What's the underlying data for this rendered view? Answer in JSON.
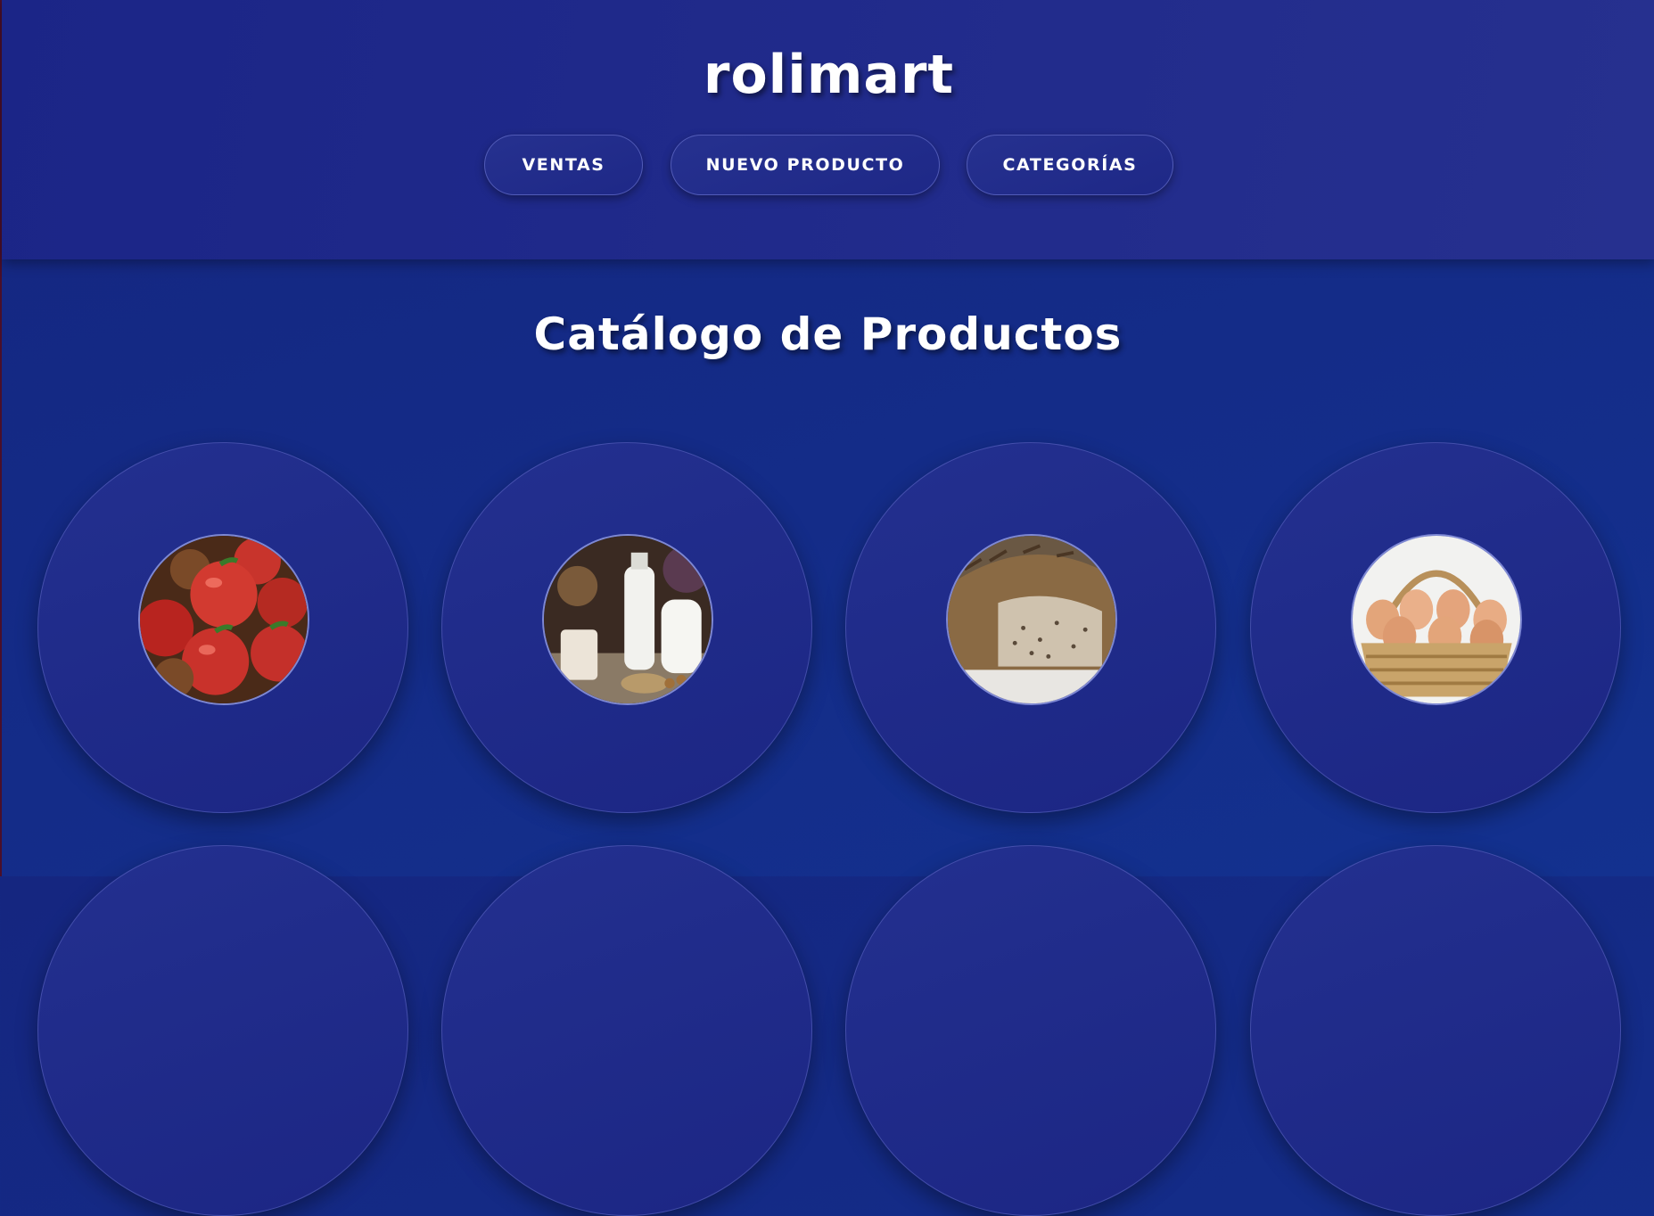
{
  "header": {
    "brand": "rolimart",
    "nav": [
      {
        "label": "VENTAS"
      },
      {
        "label": "NUEVO PRODUCTO"
      },
      {
        "label": "CATEGORÍAS"
      }
    ]
  },
  "main": {
    "title": "Catálogo de Productos",
    "products": [
      {
        "image": "apples-photo"
      },
      {
        "image": "milk-bottles-photo"
      },
      {
        "image": "bread-loaf-photo"
      },
      {
        "image": "eggs-basket-photo"
      }
    ]
  },
  "colors": {
    "background": "#152680",
    "header": "#1b2587",
    "card": "#23308f",
    "text": "#ffffff"
  }
}
